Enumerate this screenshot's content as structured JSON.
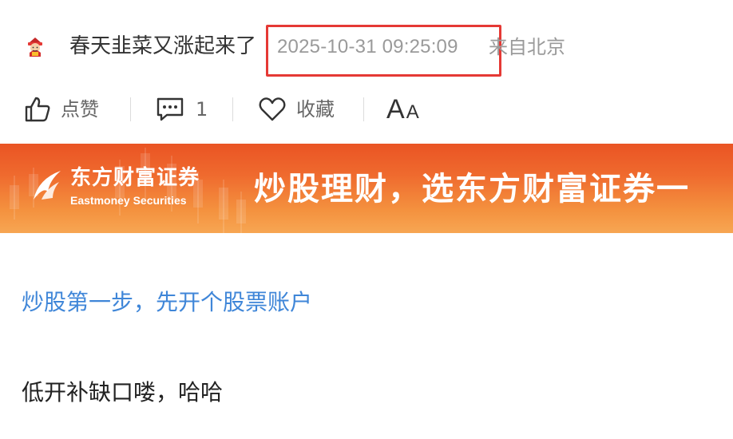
{
  "post": {
    "author": {
      "name": "春天韭菜又涨起来了",
      "avatar_icon": "fortune-god-avatar"
    },
    "timestamp": "2025-10-31 09:25:09",
    "location": "来自北京",
    "highlight_color": "#e53935"
  },
  "actions": {
    "like_label": "点赞",
    "comment_count": "1",
    "favorite_label": "收藏",
    "font_size_big": "A",
    "font_size_small": "A"
  },
  "banner": {
    "brand_name": "东方财富证券",
    "brand_name_en": "Eastmoney Securities",
    "slogan": "炒股理财，选东方财富证券一",
    "background_colors": [
      "#ea5424",
      "#f7a653"
    ]
  },
  "promo_link": "炒股第一步，先开个股票账户",
  "body_text": "低开补缺口喽，哈哈",
  "colors": {
    "link": "#3f86d8",
    "meta_text": "#9a9a9a"
  }
}
